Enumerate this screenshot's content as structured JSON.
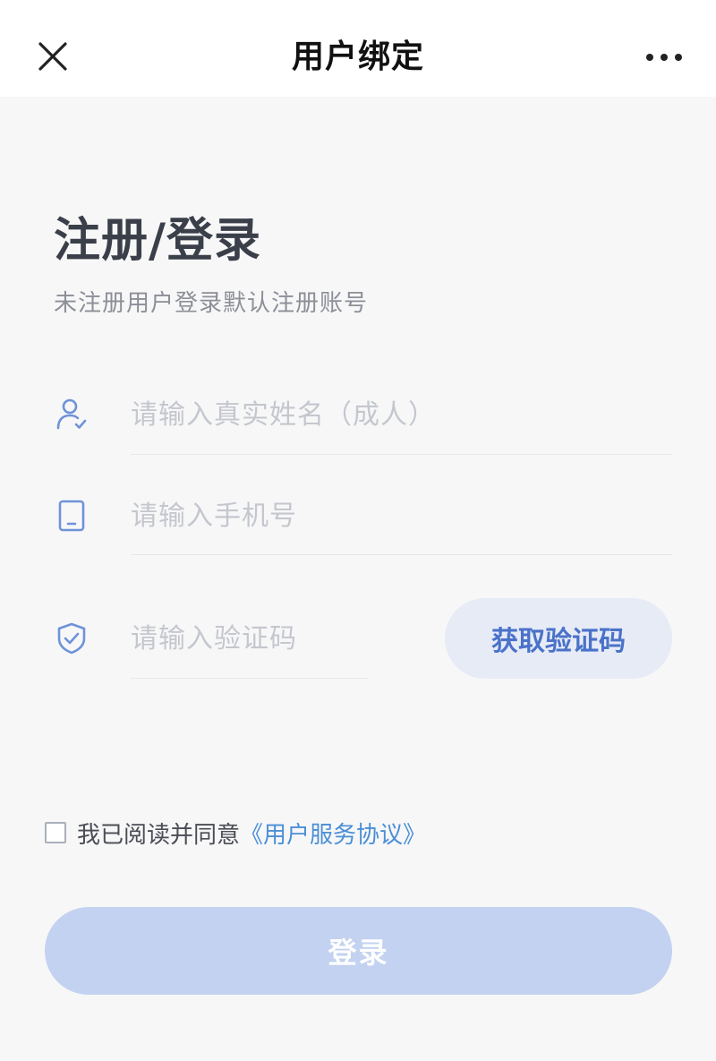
{
  "nav": {
    "title": "用户绑定",
    "close_icon": "close-icon",
    "more_icon": "more-icon"
  },
  "header": {
    "title": "注册/登录",
    "subtitle": "未注册用户登录默认注册账号"
  },
  "form": {
    "name_placeholder": "请输入真实姓名（成人）",
    "phone_placeholder": "请输入手机号",
    "code_placeholder": "请输入验证码",
    "get_code_label": "获取验证码"
  },
  "agreement": {
    "text": "我已阅读并同意",
    "link": "《用户服务协议》",
    "checked": false
  },
  "login_label": "登录",
  "colors": {
    "accent": "#4a72c9",
    "link": "#4b8fd6",
    "login_disabled": "#c3d2f0",
    "icon": "#6e93d8"
  }
}
